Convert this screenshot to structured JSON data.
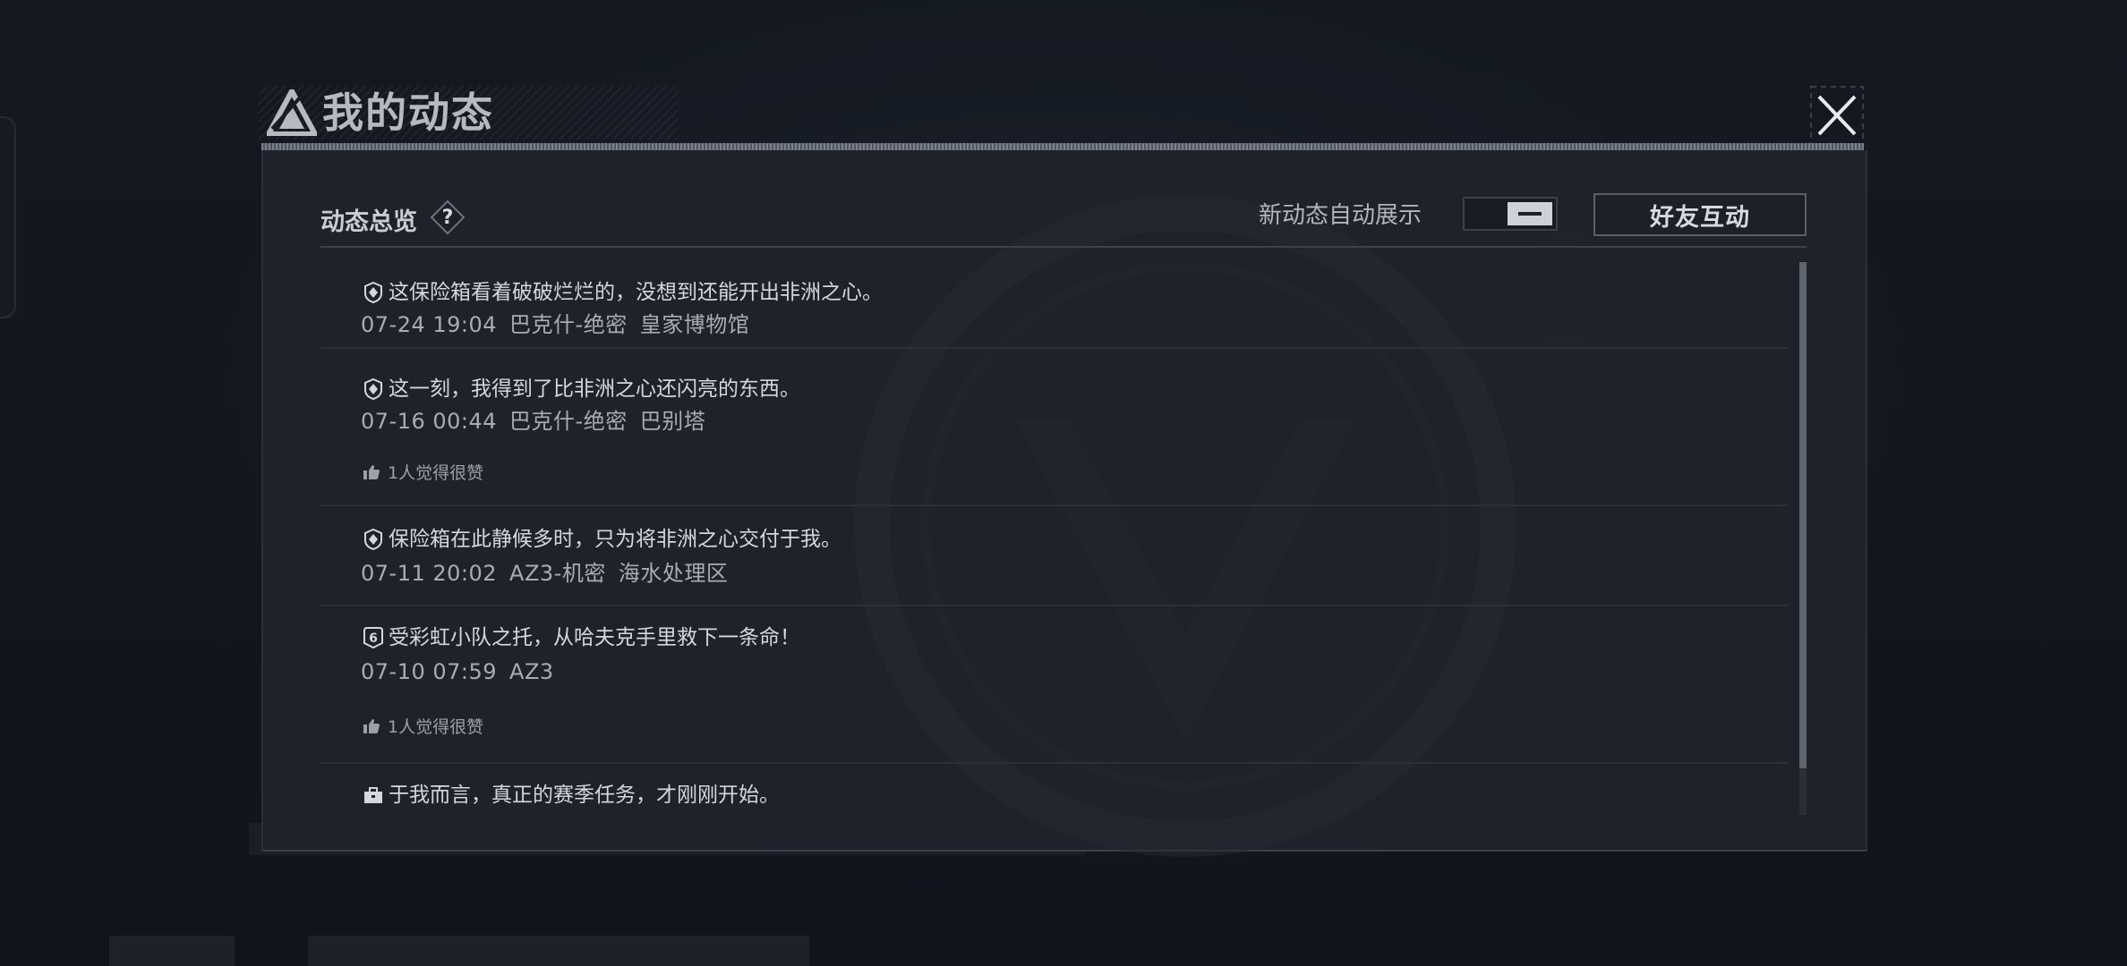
{
  "window": {
    "title": "我的动态",
    "overview_title": "动态总览",
    "help_label": "?",
    "auto_show_label": "新动态自动展示",
    "friend_button_label": "好友互动"
  },
  "colors": {
    "background": "#12161e",
    "panel": "#1e232b",
    "text_primary": "#d3d7de",
    "text_secondary": "#a7acb5",
    "toggle_knob": "#cdd2d9"
  },
  "feed": [
    {
      "icon": "shield-badge-icon",
      "text": "这保险箱看着破破烂烂的，没想到还能开出非洲之心。",
      "time": "07-24 19:04",
      "mode": "巴克什-绝密",
      "location": "皇家博物馆",
      "likes": ""
    },
    {
      "icon": "shield-badge-icon",
      "text": "这一刻，我得到了比非洲之心还闪亮的东西。",
      "time": "07-16 00:44",
      "mode": "巴克什-绝密",
      "location": "巴别塔",
      "likes": "1人觉得很赞"
    },
    {
      "icon": "shield-badge-icon",
      "text": "保险箱在此静候多时，只为将非洲之心交付于我。",
      "time": "07-11 20:02",
      "mode": "AZ3-机密",
      "location": "海水处理区",
      "likes": ""
    },
    {
      "icon": "number-six-badge-icon",
      "text": "受彩虹小队之托，从哈夫克手里救下一条命！",
      "time": "07-10 07:59",
      "mode": "AZ3",
      "location": "",
      "likes": "1人觉得很赞"
    },
    {
      "icon": "briefcase-icon",
      "text": "于我而言，真正的赛季任务，才刚刚开始。",
      "time": "",
      "mode": "",
      "location": "",
      "likes": ""
    }
  ],
  "toggle": {
    "state": "on"
  }
}
